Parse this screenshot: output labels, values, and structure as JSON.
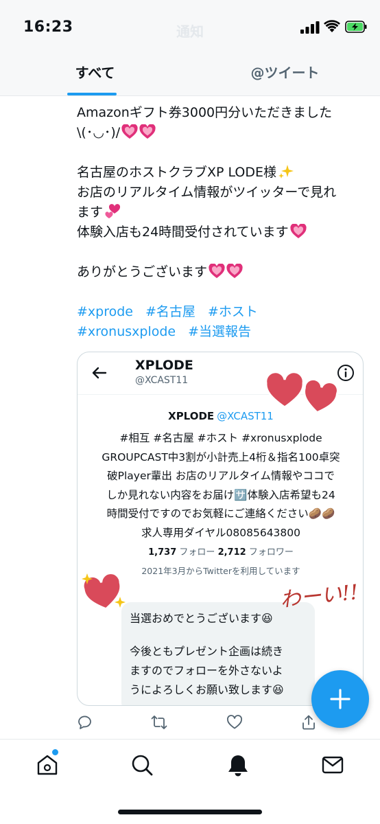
{
  "status_bar": {
    "time": "16:23",
    "title": "通知"
  },
  "tabs": [
    {
      "label": "すべて",
      "active": true
    },
    {
      "label": "@ツイート",
      "active": false
    }
  ],
  "tweet": {
    "line1": "Amazonギフト券3000円分いただきました",
    "line2": "\\(･◡･)/",
    "line3": "名古屋のホストクラブXP LODE様",
    "line4": "お店のリアルタイム情報がツイッターで見れ",
    "line5": "ます",
    "line6": "体験入店も24時間受付されています",
    "line7": "ありがとうございます",
    "hashtags": [
      "#xprode",
      "#名古屋",
      "#ホスト",
      "#xronusxplode",
      "#当選報告"
    ]
  },
  "card": {
    "name": "XPLODE",
    "handle": "@XCAST11",
    "profile_name": "XPLODE",
    "profile_handle": "@XCAST11",
    "bio": [
      "#相互 #名古屋 #ホスト #xronusxplode",
      "GROUPCAST中3割が小計売上4桁＆指名100卓突",
      "破Player輩出 お店のリアルタイム情報やココで",
      "しか見れない内容をお届け🈂️体験入店希望も24",
      "時間受付ですのでお気軽にご連絡ください🥔🥔",
      "求人専用ダイヤル08085643800"
    ],
    "following_count": "1,737",
    "following_label": "フォロー",
    "followers_count": "2,712",
    "followers_label": "フォロワー",
    "joined": "2021年3月からTwitterを利用しています",
    "dm_lines": [
      "当選おめでとうございます😆",
      "今後ともプレゼント企画は続き",
      "ますのでフォローを外さないよ",
      "うによろしくお願い致します😆"
    ],
    "handwritten": "わーい!!"
  },
  "colors": {
    "accent": "#1d9bf0",
    "heart_pink": "#e0307a",
    "sticker_red": "#d94a5a"
  },
  "icons": {
    "actions": [
      "reply-icon",
      "retweet-icon",
      "like-icon",
      "share-icon"
    ],
    "nav": [
      "home-icon",
      "search-icon",
      "notifications-icon",
      "messages-icon"
    ],
    "fab": "compose-plus-icon"
  }
}
